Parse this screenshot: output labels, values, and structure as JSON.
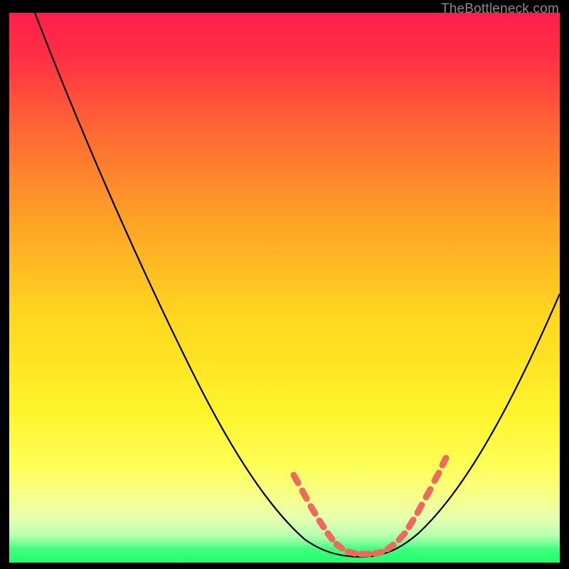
{
  "attribution": "TheBottleneck.com",
  "colors": {
    "bg": "#000000",
    "gradient_top": "#ff1f4a",
    "gradient_mid_upper": "#ff8a2a",
    "gradient_mid": "#ffd61f",
    "gradient_mid_lower": "#fffb40",
    "gradient_lower": "#f7ff8f",
    "gradient_bottom": "#2bff73",
    "curve": "#000000",
    "marker": "#ec6a5e"
  },
  "chart_data": {
    "type": "line",
    "title": "",
    "xlabel": "",
    "ylabel": "",
    "xlim": [
      0,
      100
    ],
    "ylim": [
      0,
      100
    ],
    "series": [
      {
        "name": "bottleneck-curve",
        "x": [
          5,
          10,
          15,
          20,
          25,
          30,
          35,
          40,
          45,
          50,
          55,
          59,
          62,
          65,
          70,
          75,
          80,
          85,
          90,
          95,
          100
        ],
        "y": [
          100,
          90,
          80,
          70,
          60,
          50,
          42,
          34,
          26,
          18,
          10,
          3,
          1,
          1,
          3,
          10,
          18,
          26,
          34,
          42,
          50
        ]
      }
    ],
    "markers": {
      "name": "highlighted-points",
      "x": [
        52,
        53,
        54,
        56,
        57,
        59,
        61,
        63,
        65,
        67,
        69,
        70,
        72,
        74,
        76,
        77
      ],
      "y": [
        14,
        12,
        10,
        7,
        5,
        3,
        1.5,
        1,
        1,
        1.5,
        3,
        5,
        8,
        11,
        14,
        16
      ]
    }
  }
}
